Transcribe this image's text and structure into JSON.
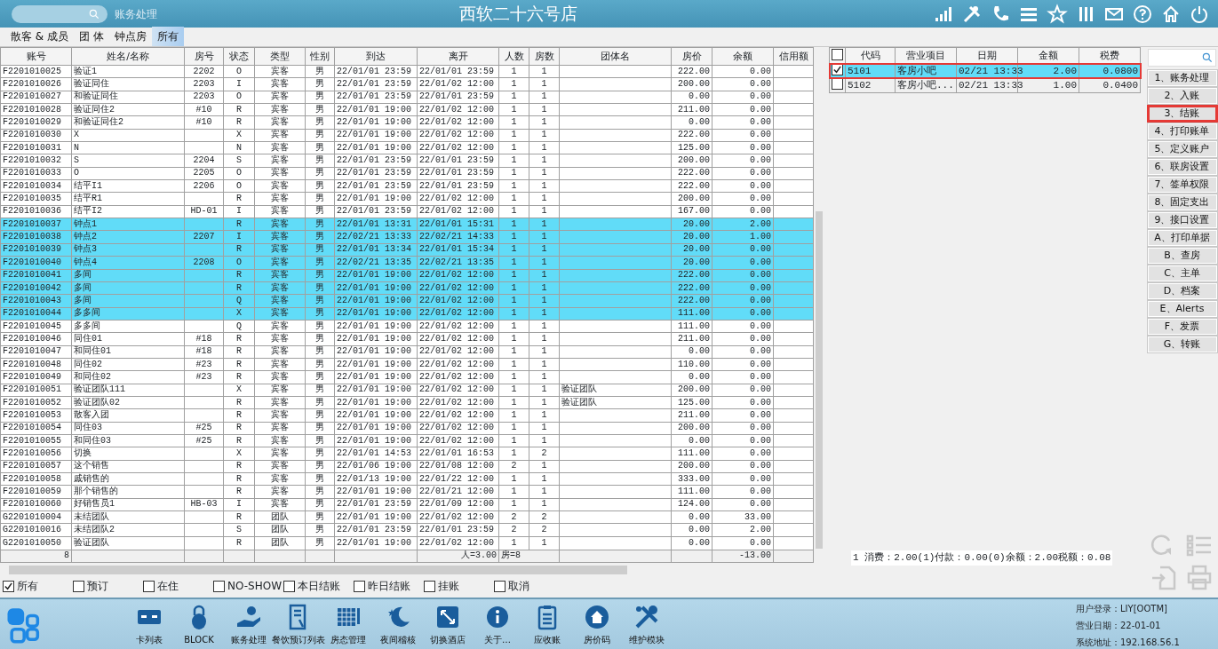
{
  "top_bar": {
    "module": "账务处理",
    "title": "西软二十六号店"
  },
  "tabs": [
    {
      "label": "散客 & 成员",
      "selected": false
    },
    {
      "label": "团 体",
      "selected": false
    },
    {
      "label": "钟点房",
      "selected": false
    },
    {
      "label": "所有",
      "selected": true
    }
  ],
  "table": {
    "columns": [
      "账号",
      "姓名/名称",
      "房号",
      "状态",
      "类型",
      "性别",
      "到达",
      "离开",
      "人数",
      "房数",
      "团体名",
      "房价",
      "余额",
      "信用额"
    ],
    "rows": [
      {
        "cells": [
          "F2201010025",
          "验证1",
          "2202",
          "O",
          "宾客",
          "男",
          "22/01/01 23:59",
          "22/01/01 23:59",
          "1",
          "1",
          "",
          "222.00",
          "0.00"
        ],
        "selected": false
      },
      {
        "cells": [
          "F2201010026",
          "验证同住",
          "2203",
          "I",
          "宾客",
          "男",
          "22/01/01 23:59",
          "22/01/02 12:00",
          "1",
          "1",
          "",
          "200.00",
          "0.00"
        ],
        "selected": false
      },
      {
        "cells": [
          "F2201010027",
          "和验证同住",
          "2203",
          "O",
          "宾客",
          "男",
          "22/01/01 23:59",
          "22/01/01 23:59",
          "1",
          "1",
          "",
          "0.00",
          "0.00"
        ],
        "selected": false
      },
      {
        "cells": [
          "F2201010028",
          "验证同住2",
          "#10",
          "R",
          "宾客",
          "男",
          "22/01/01 19:00",
          "22/01/02 12:00",
          "1",
          "1",
          "",
          "211.00",
          "0.00"
        ],
        "selected": false
      },
      {
        "cells": [
          "F2201010029",
          "和验证同住2",
          "#10",
          "R",
          "宾客",
          "男",
          "22/01/01 19:00",
          "22/01/02 12:00",
          "1",
          "1",
          "",
          "0.00",
          "0.00"
        ],
        "selected": false
      },
      {
        "cells": [
          "F2201010030",
          "X",
          "",
          "X",
          "宾客",
          "男",
          "22/01/01 19:00",
          "22/01/02 12:00",
          "1",
          "1",
          "",
          "222.00",
          "0.00"
        ],
        "selected": false
      },
      {
        "cells": [
          "F2201010031",
          "N",
          "",
          "N",
          "宾客",
          "男",
          "22/01/01 19:00",
          "22/01/02 12:00",
          "1",
          "1",
          "",
          "125.00",
          "0.00"
        ],
        "selected": false
      },
      {
        "cells": [
          "F2201010032",
          "S",
          "2204",
          "S",
          "宾客",
          "男",
          "22/01/01 23:59",
          "22/01/01 23:59",
          "1",
          "1",
          "",
          "200.00",
          "0.00"
        ],
        "selected": false
      },
      {
        "cells": [
          "F2201010033",
          "O",
          "2205",
          "O",
          "宾客",
          "男",
          "22/01/01 23:59",
          "22/01/01 23:59",
          "1",
          "1",
          "",
          "222.00",
          "0.00"
        ],
        "selected": false
      },
      {
        "cells": [
          "F2201010034",
          "结平I1",
          "2206",
          "O",
          "宾客",
          "男",
          "22/01/01 23:59",
          "22/01/01 23:59",
          "1",
          "1",
          "",
          "222.00",
          "0.00"
        ],
        "selected": false
      },
      {
        "cells": [
          "F2201010035",
          "结平R1",
          "",
          "R",
          "宾客",
          "男",
          "22/01/01 19:00",
          "22/01/02 12:00",
          "1",
          "1",
          "",
          "200.00",
          "0.00"
        ],
        "selected": false
      },
      {
        "cells": [
          "F2201010036",
          "结平I2",
          "HD-01",
          "I",
          "宾客",
          "男",
          "22/01/01 23:59",
          "22/01/02 12:00",
          "1",
          "1",
          "",
          "167.00",
          "0.00"
        ],
        "selected": false
      },
      {
        "cells": [
          "F2201010037",
          "钟点1",
          "",
          "R",
          "宾客",
          "男",
          "22/01/01 13:31",
          "22/01/01 15:31",
          "1",
          "1",
          "",
          "20.00",
          "2.00"
        ],
        "selected": true
      },
      {
        "cells": [
          "F2201010038",
          "钟点2",
          "2207",
          "I",
          "宾客",
          "男",
          "22/02/21 13:33",
          "22/02/21 14:33",
          "1",
          "1",
          "",
          "20.00",
          "1.00"
        ],
        "selected": true
      },
      {
        "cells": [
          "F2201010039",
          "钟点3",
          "",
          "R",
          "宾客",
          "男",
          "22/01/01 13:34",
          "22/01/01 15:34",
          "1",
          "1",
          "",
          "20.00",
          "0.00"
        ],
        "selected": true
      },
      {
        "cells": [
          "F2201010040",
          "钟点4",
          "2208",
          "O",
          "宾客",
          "男",
          "22/02/21 13:35",
          "22/02/21 13:35",
          "1",
          "1",
          "",
          "20.00",
          "0.00"
        ],
        "selected": true
      },
      {
        "cells": [
          "F2201010041",
          "多间",
          "",
          "R",
          "宾客",
          "男",
          "22/01/01 19:00",
          "22/01/02 12:00",
          "1",
          "1",
          "",
          "222.00",
          "0.00"
        ],
        "selected": true
      },
      {
        "cells": [
          "F2201010042",
          "多间",
          "",
          "R",
          "宾客",
          "男",
          "22/01/01 19:00",
          "22/01/02 12:00",
          "1",
          "1",
          "",
          "222.00",
          "0.00"
        ],
        "selected": true
      },
      {
        "cells": [
          "F2201010043",
          "多间",
          "",
          "Q",
          "宾客",
          "男",
          "22/01/01 19:00",
          "22/01/02 12:00",
          "1",
          "1",
          "",
          "222.00",
          "0.00"
        ],
        "selected": true
      },
      {
        "cells": [
          "F2201010044",
          "多多间",
          "",
          "X",
          "宾客",
          "男",
          "22/01/01 19:00",
          "22/01/02 12:00",
          "1",
          "1",
          "",
          "111.00",
          "0.00"
        ],
        "selected": true
      },
      {
        "cells": [
          "F2201010045",
          "多多间",
          "",
          "Q",
          "宾客",
          "男",
          "22/01/01 19:00",
          "22/01/02 12:00",
          "1",
          "1",
          "",
          "111.00",
          "0.00"
        ],
        "selected": false
      },
      {
        "cells": [
          "F2201010046",
          "同住01",
          "#18",
          "R",
          "宾客",
          "男",
          "22/01/01 19:00",
          "22/01/02 12:00",
          "1",
          "1",
          "",
          "211.00",
          "0.00"
        ],
        "selected": false
      },
      {
        "cells": [
          "F2201010047",
          "和同住01",
          "#18",
          "R",
          "宾客",
          "男",
          "22/01/01 19:00",
          "22/01/02 12:00",
          "1",
          "1",
          "",
          "0.00",
          "0.00"
        ],
        "selected": false
      },
      {
        "cells": [
          "F2201010048",
          "同住02",
          "#23",
          "R",
          "宾客",
          "男",
          "22/01/01 19:00",
          "22/01/02 12:00",
          "1",
          "1",
          "",
          "110.00",
          "0.00"
        ],
        "selected": false
      },
      {
        "cells": [
          "F2201010049",
          "和同住02",
          "#23",
          "R",
          "宾客",
          "男",
          "22/01/01 19:00",
          "22/01/02 12:00",
          "1",
          "1",
          "",
          "0.00",
          "0.00"
        ],
        "selected": false
      },
      {
        "cells": [
          "F2201010051",
          "验证团队111",
          "",
          "X",
          "宾客",
          "男",
          "22/01/01 19:00",
          "22/01/02 12:00",
          "1",
          "1",
          "验证团队",
          "200.00",
          "0.00"
        ],
        "selected": false
      },
      {
        "cells": [
          "F2201010052",
          "验证团队02",
          "",
          "R",
          "宾客",
          "男",
          "22/01/01 19:00",
          "22/01/02 12:00",
          "1",
          "1",
          "验证团队",
          "125.00",
          "0.00"
        ],
        "selected": false
      },
      {
        "cells": [
          "F2201010053",
          "散客入团",
          "",
          "R",
          "宾客",
          "男",
          "22/01/01 19:00",
          "22/01/02 12:00",
          "1",
          "1",
          "",
          "211.00",
          "0.00"
        ],
        "selected": false
      },
      {
        "cells": [
          "F2201010054",
          "同住03",
          "#25",
          "R",
          "宾客",
          "男",
          "22/01/01 19:00",
          "22/01/02 12:00",
          "1",
          "1",
          "",
          "200.00",
          "0.00"
        ],
        "selected": false
      },
      {
        "cells": [
          "F2201010055",
          "和同住03",
          "#25",
          "R",
          "宾客",
          "男",
          "22/01/01 19:00",
          "22/01/02 12:00",
          "1",
          "1",
          "",
          "0.00",
          "0.00"
        ],
        "selected": false
      },
      {
        "cells": [
          "F2201010056",
          "切换",
          "",
          "X",
          "宾客",
          "男",
          "22/01/01 14:53",
          "22/01/01 16:53",
          "1",
          "2",
          "",
          "111.00",
          "0.00"
        ],
        "selected": false
      },
      {
        "cells": [
          "F2201010057",
          "这个销售",
          "",
          "R",
          "宾客",
          "男",
          "22/01/06 19:00",
          "22/01/08 12:00",
          "2",
          "1",
          "",
          "200.00",
          "0.00"
        ],
        "selected": false
      },
      {
        "cells": [
          "F2201010058",
          "戚销售的",
          "",
          "R",
          "宾客",
          "男",
          "22/01/13 19:00",
          "22/01/22 12:00",
          "1",
          "1",
          "",
          "333.00",
          "0.00"
        ],
        "selected": false
      },
      {
        "cells": [
          "F2201010059",
          "那个销售的",
          "",
          "R",
          "宾客",
          "男",
          "22/01/01 19:00",
          "22/01/21 12:00",
          "1",
          "1",
          "",
          "111.00",
          "0.00"
        ],
        "selected": false
      },
      {
        "cells": [
          "F2201010060",
          "好销售员1",
          "HB-03",
          "I",
          "宾客",
          "男",
          "22/01/01 23:59",
          "22/01/09 12:00",
          "1",
          "1",
          "",
          "124.00",
          "0.00"
        ],
        "selected": false
      },
      {
        "cells": [
          "G2201010004",
          "未结团队",
          "",
          "R",
          "团队",
          "男",
          "22/01/01 19:00",
          "22/01/02 12:00",
          "2",
          "2",
          "",
          "0.00",
          "33.00"
        ],
        "selected": false
      },
      {
        "cells": [
          "G2201010016",
          "未结团队2",
          "",
          "S",
          "团队",
          "男",
          "22/01/01 23:59",
          "22/01/01 23:59",
          "2",
          "2",
          "",
          "0.00",
          "2.00"
        ],
        "selected": false
      },
      {
        "cells": [
          "G2201010050",
          "验证团队",
          "",
          "R",
          "团队",
          "男",
          "22/01/01 19:00",
          "22/01/02 12:00",
          "1",
          "1",
          "",
          "0.00",
          "0.00"
        ],
        "selected": false
      }
    ],
    "footer": {
      "count": "8",
      "people": "人=3.00",
      "rooms": "房=8",
      "balance": "-13.00"
    }
  },
  "filters": [
    {
      "label": "所有",
      "checked": true
    },
    {
      "label": "预订",
      "checked": false
    },
    {
      "label": "在住",
      "checked": false
    },
    {
      "label": "NO-SHOW",
      "checked": false
    },
    {
      "label": "本日结账",
      "checked": false
    },
    {
      "label": "昨日结账",
      "checked": false
    },
    {
      "label": "挂账",
      "checked": false
    },
    {
      "label": "取消",
      "checked": false
    }
  ],
  "charges": {
    "all_checked": false,
    "columns": [
      "代码",
      "营业项目",
      "日期",
      "金额",
      "税费"
    ],
    "rows": [
      {
        "cells": [
          "5101",
          "客房小吧",
          "02/21 13:33",
          "2.00",
          "0.0800"
        ],
        "checked": true,
        "selected": true,
        "annotated": true
      },
      {
        "cells": [
          "5102",
          "客房小吧...",
          "02/21 13:33",
          "1.00",
          "0.0400"
        ],
        "checked": false,
        "selected": false,
        "annotated": false
      }
    ],
    "summary": "1 消费：2.00(1)付款：0.00(0)余额：2.00税额：0.08"
  },
  "side_buttons": [
    {
      "label": "1、账务处理",
      "annotated": false
    },
    {
      "label": "2、入账",
      "annotated": false
    },
    {
      "label": "3、结账",
      "annotated": true
    },
    {
      "label": "4、打印账单",
      "annotated": false
    },
    {
      "label": "5、定义账户",
      "annotated": false
    },
    {
      "label": "6、联房设置",
      "annotated": false
    },
    {
      "label": "7、签单权限",
      "annotated": false
    },
    {
      "label": "8、固定支出",
      "annotated": false
    },
    {
      "label": "9、接口设置",
      "annotated": false
    },
    {
      "label": "A、打印单据",
      "annotated": false
    },
    {
      "label": "B、查房",
      "annotated": false
    },
    {
      "label": "C、主单",
      "annotated": false
    },
    {
      "label": "D、档案",
      "annotated": false
    },
    {
      "label": "E、Alerts",
      "annotated": false
    },
    {
      "label": "F、发票",
      "annotated": false
    },
    {
      "label": "G、转账",
      "annotated": false
    }
  ],
  "toolbar": [
    {
      "label": "卡列表"
    },
    {
      "label": "BLOCK"
    },
    {
      "label": "账务处理"
    },
    {
      "label": "餐饮预订列表"
    },
    {
      "label": "房态管理"
    },
    {
      "label": "夜间稽核"
    },
    {
      "label": "切换酒店"
    },
    {
      "label": "关于…"
    },
    {
      "label": "应收账"
    },
    {
      "label": "房价码"
    },
    {
      "label": "维护模块"
    }
  ],
  "status": [
    "用户登录：LIY[OOTM]",
    "营业日期：22-01-01",
    "系统地址：192.168.56.1"
  ]
}
